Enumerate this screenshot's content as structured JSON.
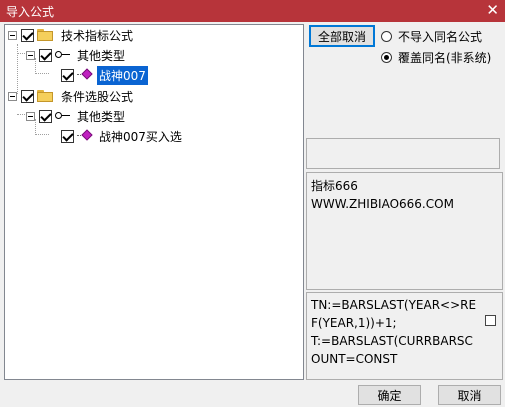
{
  "window": {
    "title": "导入公式",
    "close_glyph": "✕"
  },
  "tree": {
    "nodes": [
      {
        "label": "技术指标公式",
        "checked": true
      },
      {
        "label": "其他类型",
        "checked": true
      },
      {
        "label": "战神007",
        "checked": true,
        "selected": true
      },
      {
        "label": "条件选股公式",
        "checked": true
      },
      {
        "label": "其他类型",
        "checked": true
      },
      {
        "label": "战神007买入选",
        "checked": true
      }
    ]
  },
  "controls": {
    "select_all_cancel_label": "全部取消",
    "options": [
      {
        "label": "不导入同名公式",
        "selected": false
      },
      {
        "label": "覆盖同名(非系统)",
        "selected": true
      }
    ]
  },
  "info": {
    "line1": "指标666",
    "line2": "WWW.ZHIBIAO666.COM"
  },
  "code": {
    "text": "TN:=BARSLAST(YEAR<>REF(YEAR,1))+1;\nT:=BARSLAST(CURRBARSCOUNT=CONST"
  },
  "footer": {
    "ok_label": "确定",
    "cancel_label": "取消"
  },
  "colors": {
    "titlebar": "#b7343a",
    "selection": "#0a64d2"
  }
}
